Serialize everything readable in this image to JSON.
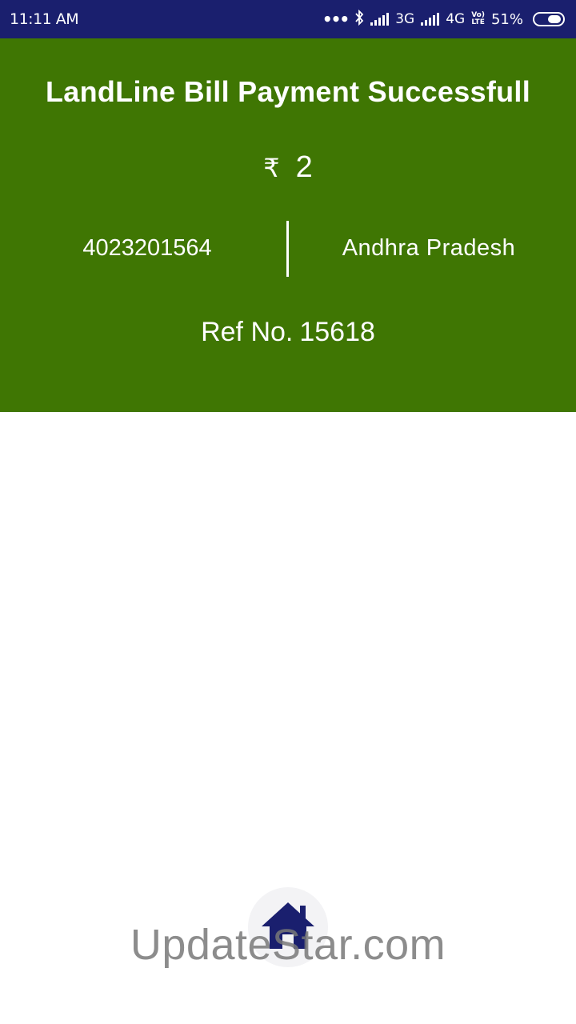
{
  "status_bar": {
    "time": "11:11 AM",
    "network1": "3G",
    "network2": "4G",
    "volte_top": "Vo)",
    "volte_bottom": "LTE",
    "battery": "51%",
    "icons": [
      "more-dots-icon",
      "bluetooth-icon",
      "signal-icon",
      "battery-icon"
    ]
  },
  "receipt": {
    "title": "LandLine Bill Payment Successfull",
    "currency_symbol": "₹",
    "amount": "2",
    "phone_number": "4023201564",
    "state": "Andhra Pradesh",
    "ref_label": "Ref No.",
    "ref_number": "15618"
  },
  "footer": {
    "home_icon": "home-icon",
    "watermark": "UpdateStar.com"
  },
  "colors": {
    "status_bar": "#1a1f6e",
    "header": "#3f7603",
    "home_icon": "#1a1f6e"
  }
}
